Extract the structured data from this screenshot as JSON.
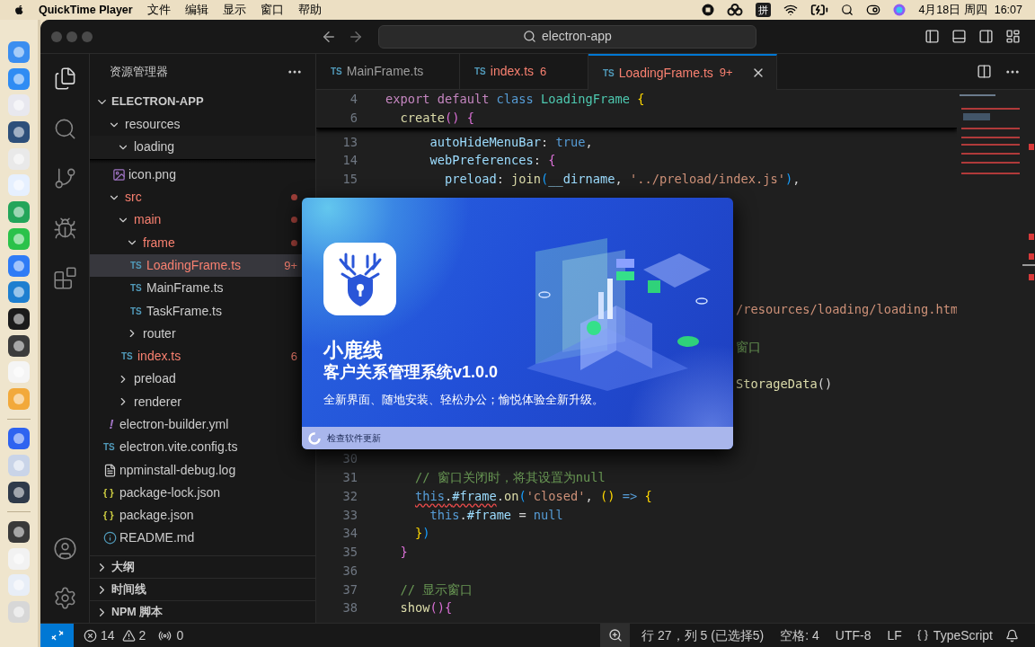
{
  "menubar": {
    "app": "QuickTime Player",
    "menus": [
      "文件",
      "编辑",
      "显示",
      "窗口",
      "帮助"
    ],
    "input_method": "拼",
    "date": "4月18日 周四",
    "time": "16:07"
  },
  "titlebar": {
    "search": "electron-app"
  },
  "explorer": {
    "title": "资源管理器",
    "root": {
      "label": "ELECTRON-APP",
      "expanded": true
    },
    "tree": [
      {
        "label": "resources",
        "kind": "folder",
        "expanded": true,
        "problem": false,
        "selected": false,
        "children": [
          {
            "label": "loading",
            "kind": "folder",
            "expanded": true,
            "sticky": true,
            "problem": false,
            "selected": false
          },
          {
            "label": "icon.png",
            "kind": "png",
            "problem": false,
            "selected": false
          }
        ]
      },
      {
        "label": "src",
        "kind": "folder",
        "expanded": true,
        "problem": true,
        "selected": false,
        "children": [
          {
            "label": "main",
            "kind": "folder",
            "expanded": true,
            "problem": true,
            "selected": false,
            "children": [
              {
                "label": "frame",
                "kind": "folder",
                "expanded": true,
                "problem": true,
                "selected": false,
                "children": [
                  {
                    "label": "LoadingFrame.ts",
                    "kind": "ts",
                    "glyph": "TS",
                    "problem": true,
                    "badge": "9+",
                    "selected": true
                  },
                  {
                    "label": "MainFrame.ts",
                    "kind": "ts",
                    "glyph": "TS",
                    "problem": false,
                    "selected": false
                  },
                  {
                    "label": "TaskFrame.ts",
                    "kind": "ts",
                    "glyph": "TS",
                    "problem": false,
                    "selected": false
                  }
                ]
              },
              {
                "label": "router",
                "kind": "folder",
                "expanded": false,
                "problem": false,
                "selected": false
              },
              {
                "label": "index.ts",
                "kind": "ts",
                "glyph": "TS",
                "problem": true,
                "badge": "6",
                "selected": false
              }
            ]
          },
          {
            "label": "preload",
            "kind": "folder",
            "expanded": false,
            "problem": false,
            "selected": false
          },
          {
            "label": "renderer",
            "kind": "folder",
            "expanded": false,
            "problem": false,
            "selected": false
          }
        ]
      },
      {
        "label": "electron-builder.yml",
        "kind": "yml",
        "glyph": "!",
        "problem": false,
        "selected": false
      },
      {
        "label": "electron.vite.config.ts",
        "kind": "ts",
        "glyph": "TS",
        "problem": false,
        "selected": false
      },
      {
        "label": "npminstall-debug.log",
        "kind": "log",
        "problem": false,
        "selected": false
      },
      {
        "label": "package-lock.json",
        "kind": "json",
        "glyph": "{ }",
        "problem": false,
        "selected": false
      },
      {
        "label": "package.json",
        "kind": "json",
        "glyph": "{ }",
        "problem": false,
        "selected": false
      },
      {
        "label": "README.md",
        "kind": "info",
        "problem": false,
        "selected": false
      }
    ],
    "sections": [
      {
        "label": "大纲",
        "expanded": false
      },
      {
        "label": "时间线",
        "expanded": false
      },
      {
        "label": "NPM 脚本",
        "expanded": false
      }
    ]
  },
  "tabs": [
    {
      "glyph": "TS",
      "label": "MainFrame.ts",
      "problem": false,
      "selected": false
    },
    {
      "glyph": "TS",
      "label": "index.ts",
      "badge": "6",
      "problem": true,
      "selected": false
    },
    {
      "glyph": "TS",
      "label": "LoadingFrame.ts",
      "badge": "9+",
      "problem": true,
      "selected": true
    }
  ],
  "editor": {
    "sticky_lines": [
      {
        "number": "4",
        "tokens": [
          {
            "text": "export default ",
            "kind": "keyword"
          },
          {
            "text": "class ",
            "kind": "constant"
          },
          {
            "text": "LoadingFrame ",
            "kind": "type"
          },
          {
            "text": "{",
            "kind": "bracket1"
          }
        ]
      },
      {
        "number": "6",
        "tokens": [
          {
            "text": "  create",
            "kind": "function"
          },
          {
            "text": "() {",
            "kind": "bracket2"
          }
        ]
      }
    ],
    "upper_lines": [
      {
        "number": "13",
        "tokens": [
          {
            "text": "      autoHideMenuBar",
            "kind": "property"
          },
          {
            "text": ": ",
            "kind": "plain"
          },
          {
            "text": "true",
            "kind": "constant"
          },
          {
            "text": ",",
            "kind": "plain"
          }
        ]
      },
      {
        "number": "14",
        "tokens": [
          {
            "text": "      webPreferences",
            "kind": "property"
          },
          {
            "text": ": ",
            "kind": "plain"
          },
          {
            "text": "{",
            "kind": "bracket2"
          }
        ]
      },
      {
        "number": "15",
        "tokens": [
          {
            "text": "        preload",
            "kind": "property"
          },
          {
            "text": ": ",
            "kind": "plain"
          },
          {
            "text": "join",
            "kind": "function"
          },
          {
            "text": "(",
            "kind": "bracket3"
          },
          {
            "text": "__dirname",
            "kind": "property"
          },
          {
            "text": ", ",
            "kind": "plain"
          },
          {
            "text": "'../preload/index.js'",
            "kind": "string"
          },
          {
            "text": ")",
            "kind": "bracket3"
          },
          {
            "text": ",",
            "kind": "plain"
          }
        ]
      }
    ],
    "tail_lines": [
      {
        "tokens": [
          {
            "text": "/resources/loading/loading.htm",
            "kind": "string"
          }
        ]
      },
      {
        "tokens": [
          {
            "text": "窗口",
            "kind": "comment"
          }
        ]
      },
      {
        "tokens": [
          {
            "text": "StorageData",
            "kind": "function"
          },
          {
            "text": "()",
            "kind": "plain"
          }
        ]
      }
    ],
    "lower_lines": [
      {
        "number": "30"
      },
      {
        "number": "31",
        "tokens": [
          {
            "text": "    // 窗口关闭时，将其设置为null",
            "kind": "comment"
          }
        ]
      },
      {
        "number": "32",
        "tokens": [
          {
            "text": "    this",
            "kind": "constant",
            "error": true
          },
          {
            "text": ".",
            "kind": "plain",
            "error": true
          },
          {
            "text": "#frame",
            "kind": "property",
            "error": true
          },
          {
            "text": ".",
            "kind": "plain"
          },
          {
            "text": "on",
            "kind": "function"
          },
          {
            "text": "(",
            "kind": "bracket3"
          },
          {
            "text": "'closed'",
            "kind": "string"
          },
          {
            "text": ", ",
            "kind": "plain"
          },
          {
            "text": "()",
            "kind": "bracket1"
          },
          {
            "text": " => ",
            "kind": "constant"
          },
          {
            "text": "{",
            "kind": "bracket1"
          }
        ]
      },
      {
        "number": "33",
        "tokens": [
          {
            "text": "      this",
            "kind": "constant"
          },
          {
            "text": ".",
            "kind": "plain"
          },
          {
            "text": "#frame",
            "kind": "property"
          },
          {
            "text": " = ",
            "kind": "plain"
          },
          {
            "text": "null",
            "kind": "constant"
          }
        ]
      },
      {
        "number": "34",
        "tokens": [
          {
            "text": "    }",
            "kind": "bracket1"
          },
          {
            "text": ")",
            "kind": "bracket3"
          }
        ]
      },
      {
        "number": "35",
        "tokens": [
          {
            "text": "  }",
            "kind": "bracket2"
          }
        ]
      },
      {
        "number": "36"
      },
      {
        "number": "37",
        "tokens": [
          {
            "text": "  // 显示窗口",
            "kind": "comment"
          }
        ]
      },
      {
        "number": "38",
        "tokens": [
          {
            "text": "  show",
            "kind": "function"
          },
          {
            "text": "(){",
            "kind": "bracket2"
          }
        ]
      }
    ]
  },
  "splash": {
    "brand": "小鹿线",
    "product": "客户关系管理系统v1.0.0",
    "tagline": "全新界面、随地安装、轻松办公；愉悦体验全新升级。",
    "status": "检查软件更新"
  },
  "status_bar": {
    "errors": "14",
    "warnings": "2",
    "ports": "0",
    "position": "行 27，列 5 (已选择5)",
    "indent": "空格: 4",
    "encoding": "UTF-8",
    "eol": "LF",
    "language": "TypeScript"
  }
}
